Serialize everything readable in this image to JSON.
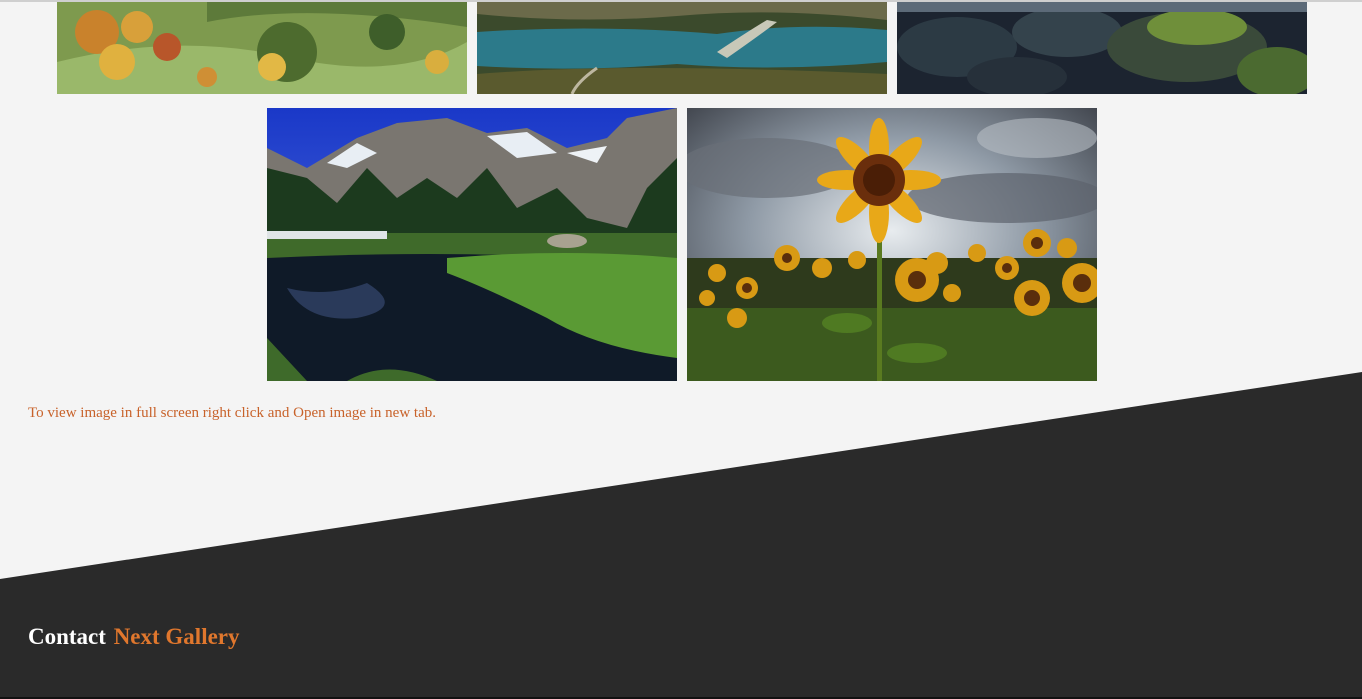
{
  "gallery": {
    "images": [
      {
        "name": "autumn-valley-photo"
      },
      {
        "name": "mountain-lake-road-photo"
      },
      {
        "name": "mossy-rocks-photo"
      },
      {
        "name": "alpine-pond-forest-photo"
      },
      {
        "name": "sunflower-field-photo"
      }
    ]
  },
  "note": {
    "text": "To view image in full screen right click and Open image in new tab."
  },
  "footer": {
    "contact_label": "Contact",
    "next_gallery_label": "Next Gallery"
  },
  "colors": {
    "background": "#f4f4f4",
    "footer_dark": "#2a2a2a",
    "accent_orange": "#e0772d",
    "note_text": "#c8622a"
  }
}
